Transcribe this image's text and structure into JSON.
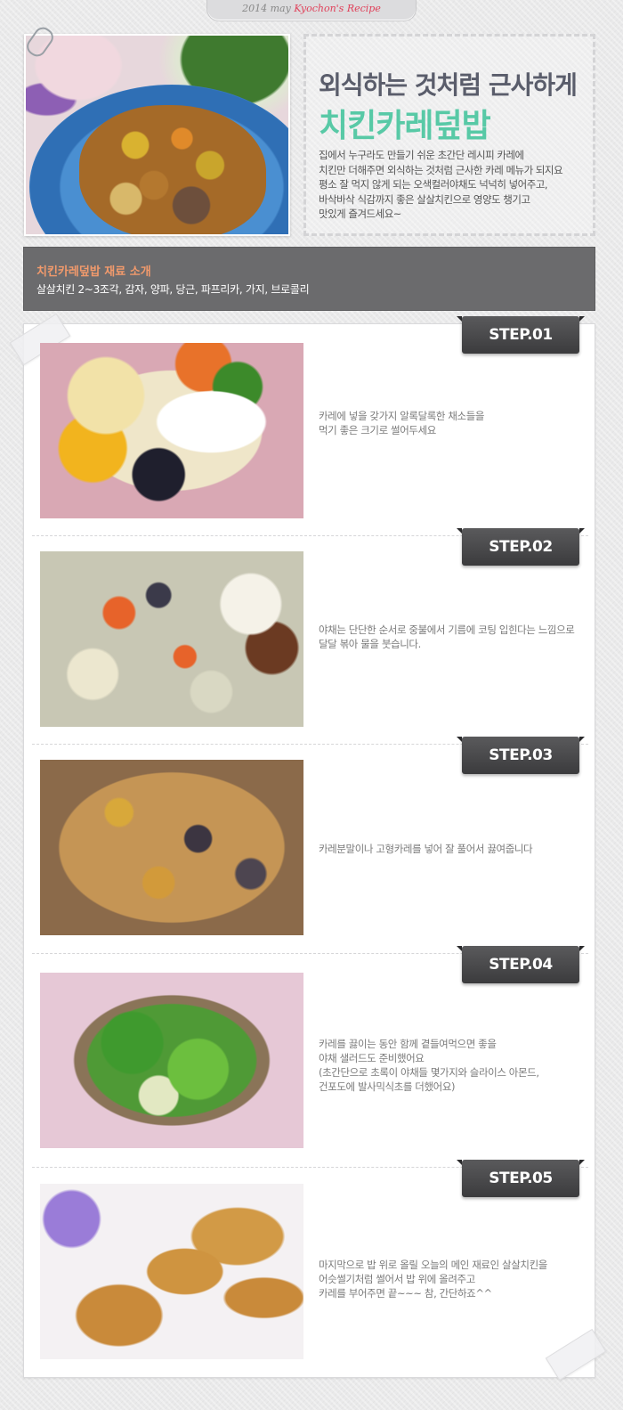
{
  "header": {
    "year": "2014 may",
    "name": "Kyochon's Recipe"
  },
  "hero": {
    "title_line1": "외식하는 것처럼 근사하게",
    "title_line2": "치킨카레덮밥",
    "desc": [
      "집에서 누구라도 만들기 쉬운 초간단 레시피 카레에",
      "치킨만 더해주면 외식하는 것처럼 근사한 카레 메뉴가 되지요",
      "평소 잘 먹지 않게 되는 오색컬러야채도 넉넉히 넣어주고,",
      "바삭바삭 식감까지 좋은 살살치킨으로 영양도 챙기고",
      "맛있게 즐겨드세요~"
    ]
  },
  "ingredients": {
    "title": "치킨카레덮밥 재료 소개",
    "list": "살살치킨 2~3조각, 감자, 양파, 당근, 파프리카, 가지, 브로콜리"
  },
  "steps": [
    {
      "label": "STEP.01",
      "text": [
        "카레에 넣을 갖가지 알록달록한 채소들을",
        "먹기 좋은 크기로 썰어두세요"
      ]
    },
    {
      "label": "STEP.02",
      "text": [
        "야채는 단단한 순서로 중불에서 기름에 코팅 입힌다는 느낌으로",
        "달달 볶아 물을 붓습니다."
      ]
    },
    {
      "label": "STEP.03",
      "text": [
        "카레분말이나 고형카레를 넣어 잘 풀어서 끓여줍니다"
      ]
    },
    {
      "label": "STEP.04",
      "text": [
        "카레를 끓이는 동안 함께 곁들여먹으면 좋을",
        "야채 샐러드도 준비했어요",
        "(초간단으로 초록이 야채들 몇가지와 슬라이스 아몬드,",
        "  건포도에 발사믹식초를 더했어요)"
      ]
    },
    {
      "label": "STEP.05",
      "text": [
        "마지막으로 밥 위로 올릴 오늘의 메인 재료인 살살치킨을",
        "어슷썰기처럼 썰어서 밥 위에 올려주고",
        "카레를 부어주면 끝~~~ 참, 간단하죠^^"
      ]
    }
  ]
}
